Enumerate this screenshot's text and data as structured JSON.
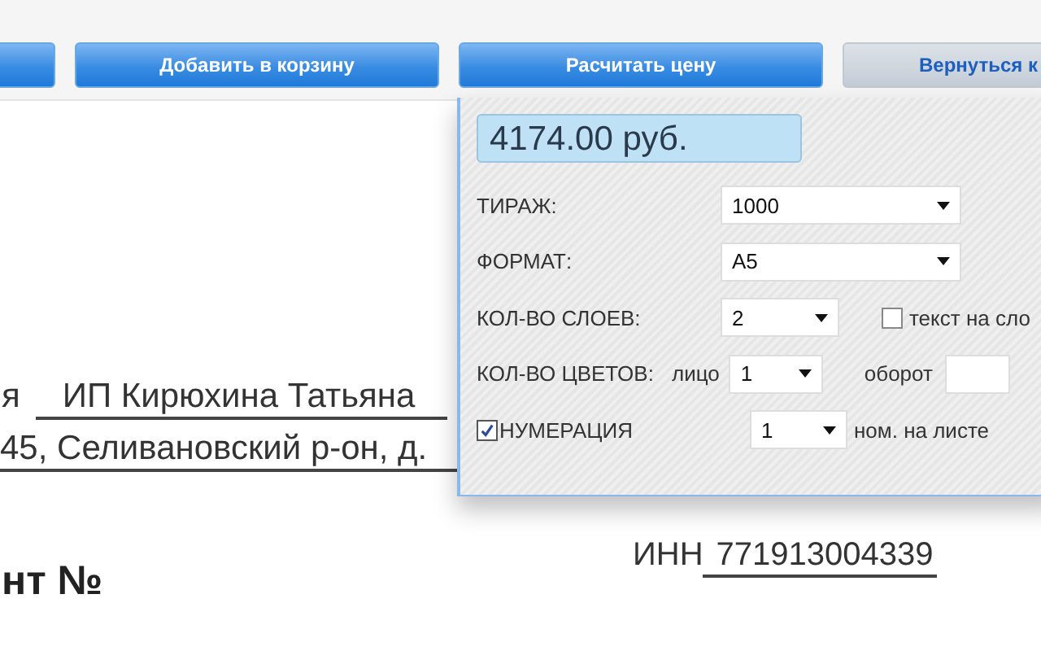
{
  "toolbar": {
    "buttons": [
      {
        "kind": "primary"
      },
      {
        "label": "Добавить в корзину",
        "kind": "primary"
      },
      {
        "label": "Расчитать цену",
        "kind": "primary"
      },
      {
        "label": "Вернуться к",
        "kind": "secondary"
      }
    ]
  },
  "document": {
    "recipient_prefix": "я",
    "recipient": "ИП Кирюхина Татьяна",
    "address": "45, Селивановский р-он, д.",
    "inn_label": "ИНН",
    "inn": "771913004339",
    "heading": "нт №"
  },
  "calculator": {
    "price": "4174.00 руб.",
    "rows": [
      {
        "kind": "select",
        "label": "ТИРАЖ:",
        "value": "1000"
      },
      {
        "kind": "select",
        "label": "ФОРМАТ:",
        "value": "А5"
      },
      {
        "kind": "layers",
        "label": "КОЛ-ВО СЛОЕВ:",
        "value": "2",
        "option": {
          "label": "текст на сло",
          "checked": false
        }
      },
      {
        "kind": "colors",
        "label": "КОЛ-ВО ЦВЕТОВ:",
        "front_label": "лицо",
        "front_value": "1",
        "back_label": "оборот"
      },
      {
        "kind": "numbering",
        "label": "НУМЕРАЦИЯ",
        "checked": true,
        "value": "1",
        "suffix": "ном. на листе"
      }
    ]
  }
}
